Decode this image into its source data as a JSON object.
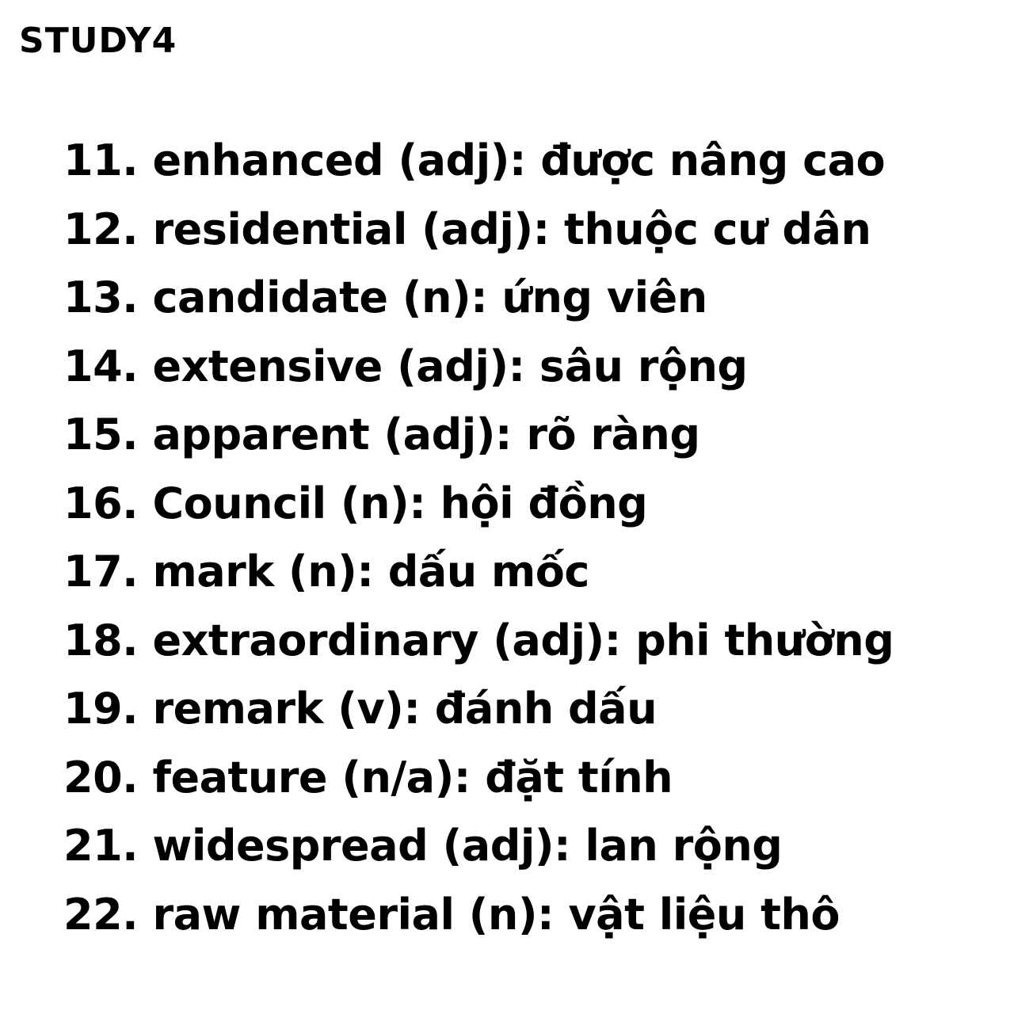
{
  "brand": "STUDY4",
  "vocab": [
    "11. enhanced (adj): được nâng cao",
    "12. residential (adj): thuộc cư dân",
    "13. candidate (n): ứng viên",
    "14. extensive (adj): sâu rộng",
    "15. apparent (adj): rõ ràng",
    "16. Council (n): hội đồng",
    "17. mark (n): dấu mốc",
    "18. extraordinary (adj): phi thường",
    "19. remark (v): đánh dấu",
    "20. feature (n/a): đặt tính",
    "21. widespread (adj): lan rộng",
    "22. raw material (n): vật liệu thô"
  ]
}
